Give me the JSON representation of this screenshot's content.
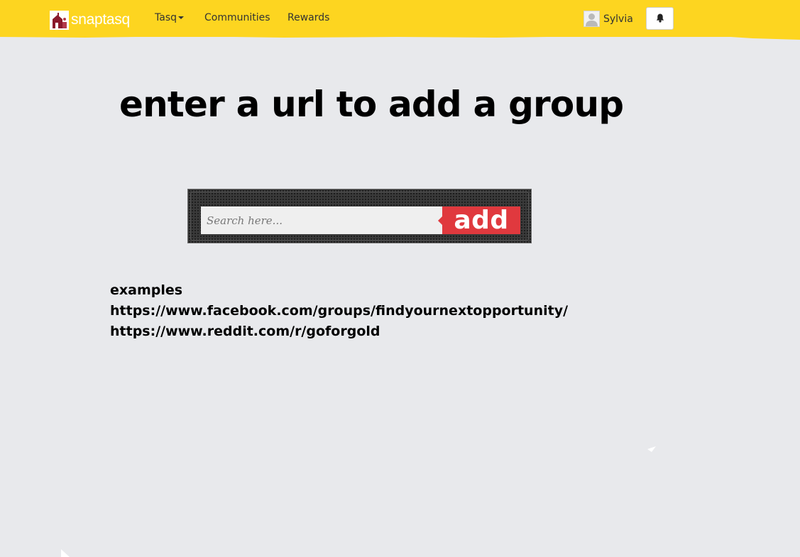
{
  "header": {
    "logo_text": "snaptasq",
    "logo_icon": "house-icon",
    "nav": [
      {
        "label": "Tasq",
        "has_dropdown": true
      },
      {
        "label": "Communities"
      },
      {
        "label": "Rewards"
      }
    ],
    "user": {
      "name": "Sylvia",
      "avatar_icon": "user-avatar-icon"
    },
    "notification_icon": "bell-icon",
    "brand_color": "#fdd520"
  },
  "main": {
    "headline": "enter a url to add a group",
    "search": {
      "placeholder": "Search here...",
      "value": "",
      "button_label": "add",
      "button_color": "#e0393e"
    },
    "examples": {
      "heading": "examples",
      "links": [
        "https://www.facebook.com/groups/findyournextopportunity/",
        "https://www.reddit.com/r/goforgold"
      ]
    }
  }
}
